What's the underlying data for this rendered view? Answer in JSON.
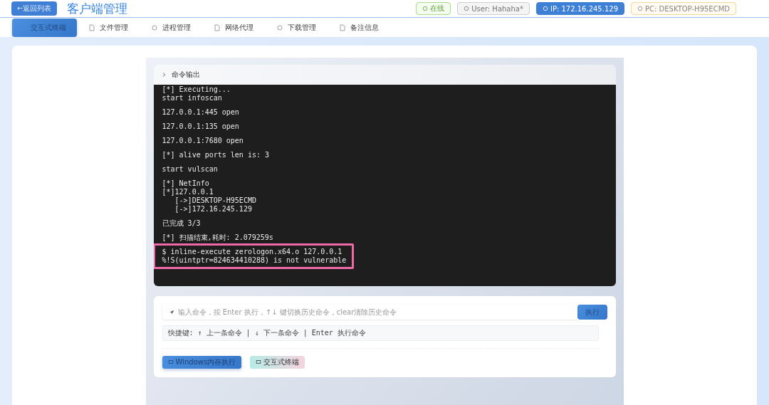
{
  "header": {
    "back_button": "←返回列表",
    "title": "客户端管理",
    "badges": [
      {
        "kind": "success",
        "text": "在线"
      },
      {
        "kind": "info",
        "text": "User: Hahaha*"
      },
      {
        "kind": "primary",
        "text": "IP: 172.16.245.129"
      },
      {
        "kind": "warning",
        "text": "PC: DESKTOP-H95ECMD"
      }
    ]
  },
  "tabs": [
    {
      "label": "交互式终端",
      "selected": true
    },
    {
      "label": "文件管理",
      "selected": false
    },
    {
      "label": "进程管理",
      "selected": false
    },
    {
      "label": "网络代理",
      "selected": false
    },
    {
      "label": "下载管理",
      "selected": false
    },
    {
      "label": "备注信息",
      "selected": false
    }
  ],
  "output": {
    "title": "命令输出",
    "blocks": [
      {
        "highlighted": false,
        "lines": [
          "[*] Executing...",
          "start infoscan"
        ]
      },
      {
        "highlighted": false,
        "lines": [
          "127.0.0.1:445 open"
        ]
      },
      {
        "highlighted": false,
        "lines": [
          "127.0.0.1:135 open"
        ]
      },
      {
        "highlighted": false,
        "lines": [
          "127.0.0.1:7680 open"
        ]
      },
      {
        "highlighted": false,
        "lines": [
          "[*] alive ports len is: 3"
        ]
      },
      {
        "highlighted": false,
        "lines": [
          "start vulscan"
        ]
      },
      {
        "highlighted": false,
        "lines": [
          "[*] NetInfo",
          "[*]127.0.0.1",
          "   [->]DESKTOP-H95ECMD",
          "   [->]172.16.245.129"
        ]
      },
      {
        "highlighted": false,
        "lines": [
          "已完成 3/3"
        ]
      },
      {
        "highlighted": false,
        "lines": [
          "[*] 扫描结束,耗时: 2.079259s"
        ]
      },
      {
        "highlighted": true,
        "lines": [
          "$ inline-execute zerologon.x64.o 127.0.0.1",
          "%!S(uintptr=824634410288) is not vulnerable"
        ]
      }
    ]
  },
  "command": {
    "placeholder": "输入命令，按 Enter 执行，↑↓ 键切换历史命令，clear清除历史命令",
    "run_button": "执行",
    "hint": "快捷键: ↑ 上一条命令 | ↓ 下一条命令 | Enter 执行命令",
    "actions": [
      {
        "kind": "primary",
        "label": "Windows内存执行"
      },
      {
        "kind": "gradient",
        "label": "交互式终端"
      }
    ]
  }
}
